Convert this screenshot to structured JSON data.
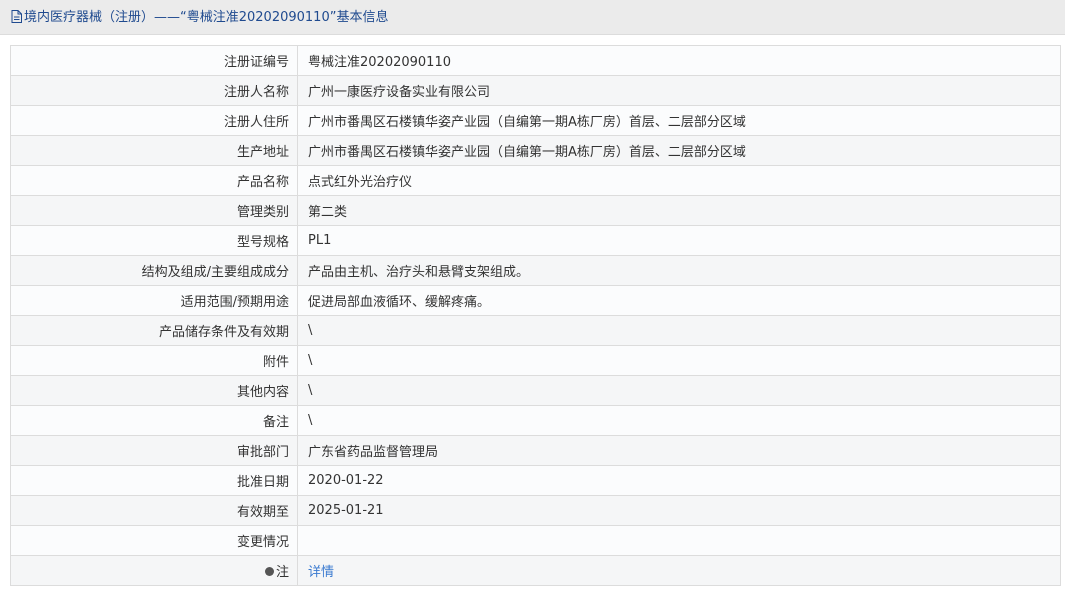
{
  "header": {
    "icon": "document-icon",
    "title": "境内医疗器械（注册）——“粤械注准20202090110”基本信息"
  },
  "rows": [
    {
      "label": "注册证编号",
      "value": "粤械注准20202090110"
    },
    {
      "label": "注册人名称",
      "value": "广州一康医疗设备实业有限公司"
    },
    {
      "label": "注册人住所",
      "value": "广州市番禺区石楼镇华姿产业园（自编第一期A栋厂房）首层、二层部分区域"
    },
    {
      "label": "生产地址",
      "value": "广州市番禺区石楼镇华姿产业园（自编第一期A栋厂房）首层、二层部分区域"
    },
    {
      "label": "产品名称",
      "value": "点式红外光治疗仪"
    },
    {
      "label": "管理类别",
      "value": "第二类"
    },
    {
      "label": "型号规格",
      "value": "PL1"
    },
    {
      "label": "结构及组成/主要组成成分",
      "value": "产品由主机、治疗头和悬臂支架组成。"
    },
    {
      "label": "适用范围/预期用途",
      "value": "促进局部血液循环、缓解疼痛。"
    },
    {
      "label": "产品储存条件及有效期",
      "value": "\\"
    },
    {
      "label": "附件",
      "value": "\\"
    },
    {
      "label": "其他内容",
      "value": "\\"
    },
    {
      "label": "备注",
      "value": "\\"
    },
    {
      "label": "审批部门",
      "value": "广东省药品监督管理局"
    },
    {
      "label": "批准日期",
      "value": "2020-01-22"
    },
    {
      "label": "有效期至",
      "value": "2025-01-21"
    },
    {
      "label": "变更情况",
      "value": ""
    }
  ],
  "note_row": {
    "icon": "info-icon",
    "label": "注",
    "link_text": "详情"
  },
  "colors": {
    "title": "#1f4a8f",
    "link": "#3a7ad0",
    "border": "#dcdcdc",
    "header_bg": "#ebebeb"
  }
}
